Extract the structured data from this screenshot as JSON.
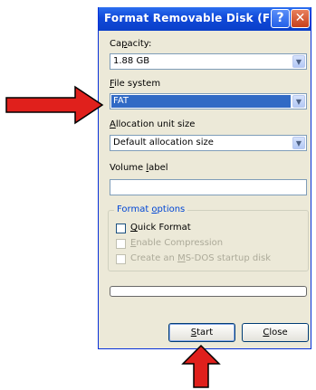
{
  "window": {
    "title": "Format Removable Disk (F:)",
    "help_glyph": "?",
    "close_glyph": "✕"
  },
  "capacity": {
    "label_pre": "Ca",
    "label_key": "p",
    "label_post": "acity:",
    "value": "1.88 GB"
  },
  "file_system": {
    "label_key": "F",
    "label_post": "ile system",
    "value": "FAT"
  },
  "allocation": {
    "label_key": "A",
    "label_post": "llocation unit size",
    "value": "Default allocation size"
  },
  "volume": {
    "label_pre": "Volume ",
    "label_key": "l",
    "label_post": "abel",
    "value": ""
  },
  "format_options": {
    "legend_pre": "Format ",
    "legend_key": "o",
    "legend_post": "ptions",
    "quick": {
      "key": "Q",
      "post": "uick Format",
      "checked": false,
      "enabled": true
    },
    "compression": {
      "key": "E",
      "post": "nable Compression",
      "checked": false,
      "enabled": false
    },
    "msdos": {
      "pre": "Create an ",
      "key": "M",
      "post": "S-DOS startup disk",
      "checked": false,
      "enabled": false
    }
  },
  "progress": {
    "value": 0
  },
  "buttons": {
    "start": {
      "key": "S",
      "post": "tart"
    },
    "close": {
      "key": "C",
      "post": "lose"
    }
  },
  "colors": {
    "titlebar": "#0a3fc9",
    "annotation_arrow": "#e0201c",
    "selection": "#316ac5"
  },
  "icons": [
    "help-icon",
    "close-icon",
    "dropdown-arrow-icon",
    "red-arrow-annotation"
  ]
}
